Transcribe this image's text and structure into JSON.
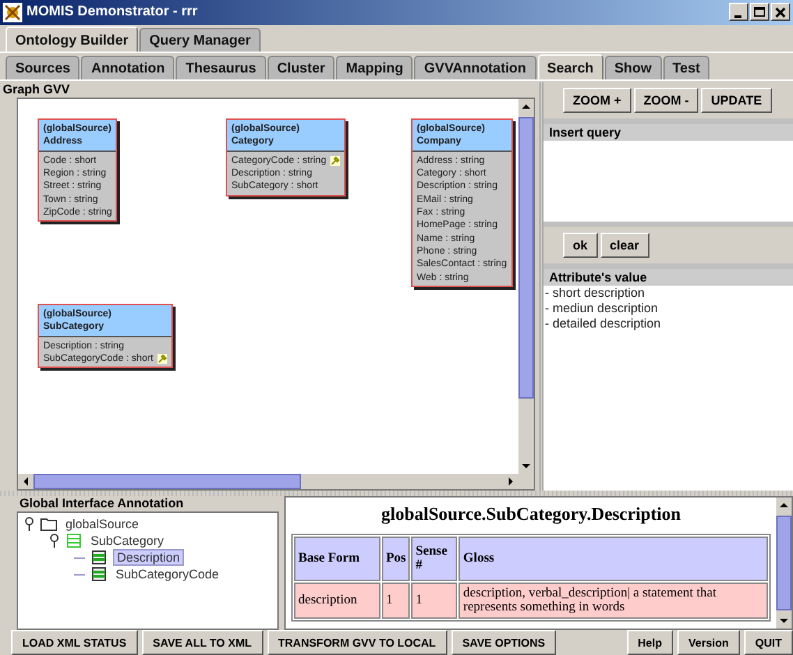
{
  "window": {
    "title": "MOMIS Demonstrator - rrr"
  },
  "top_tabs": [
    {
      "label": "Ontology Builder",
      "selected": true
    },
    {
      "label": "Query Manager",
      "selected": false
    }
  ],
  "tabs": [
    {
      "label": "Sources",
      "selected": false
    },
    {
      "label": "Annotation",
      "selected": false
    },
    {
      "label": "Thesaurus",
      "selected": false
    },
    {
      "label": "Cluster",
      "selected": false
    },
    {
      "label": "Mapping",
      "selected": false
    },
    {
      "label": "GVVAnnotation",
      "selected": false
    },
    {
      "label": "Search",
      "selected": true
    },
    {
      "label": "Show",
      "selected": false
    },
    {
      "label": "Test",
      "selected": false
    }
  ],
  "graph": {
    "title": "Graph GVV",
    "nodes": [
      {
        "source": "(globalSource)",
        "name": "Address",
        "attributes": [
          {
            "text": "Code : short",
            "key": false
          },
          {
            "text": "Region : string",
            "key": false
          },
          {
            "text": "Street : string",
            "key": false
          },
          {
            "text": "Town : string",
            "key": false
          },
          {
            "text": "ZipCode : string",
            "key": false
          }
        ]
      },
      {
        "source": "(globalSource)",
        "name": "Category",
        "attributes": [
          {
            "text": "CategoryCode : string",
            "key": true
          },
          {
            "text": "Description : string",
            "key": false
          },
          {
            "text": "SubCategory : short",
            "key": false
          }
        ]
      },
      {
        "source": "(globalSource)",
        "name": "Company",
        "attributes": [
          {
            "text": "Address : string",
            "key": false
          },
          {
            "text": "Category : short",
            "key": false
          },
          {
            "text": "Description : string",
            "key": false
          },
          {
            "text": "EMail : string",
            "key": false
          },
          {
            "text": "Fax : string",
            "key": false
          },
          {
            "text": "HomePage : string",
            "key": false
          },
          {
            "text": "Name : string",
            "key": false
          },
          {
            "text": "Phone : string",
            "key": false
          },
          {
            "text": "SalesContact : string",
            "key": false
          },
          {
            "text": "Web : string",
            "key": false
          }
        ]
      },
      {
        "source": "(globalSource)",
        "name": "SubCategory",
        "attributes": [
          {
            "text": "Description : string",
            "key": false
          },
          {
            "text": "SubCategoryCode : short",
            "key": true
          }
        ]
      }
    ]
  },
  "graph_buttons": [
    "ZOOM +",
    "ZOOM -",
    "UPDATE"
  ],
  "query": {
    "title": "Insert query",
    "buttons": [
      "ok",
      "clear"
    ]
  },
  "attribute_values": {
    "title": "Attribute's value",
    "items": [
      "- short description",
      "- mediun description",
      "- detailed description"
    ]
  },
  "annotation_tree": {
    "title": "Global Interface Annotation",
    "items": [
      {
        "label": "globalSource",
        "kind": "folder",
        "expanded": true,
        "selected": false,
        "children": [
          {
            "label": "SubCategory",
            "kind": "table",
            "expanded": true,
            "selected": false,
            "children": [
              {
                "label": "Description",
                "kind": "field",
                "selected": true
              },
              {
                "label": "SubCategoryCode",
                "kind": "field",
                "selected": false
              }
            ]
          }
        ]
      }
    ]
  },
  "gloss": {
    "heading": "globalSource.SubCategory.Description",
    "columns": [
      "Base Form",
      "Pos",
      "Sense #",
      "Gloss"
    ],
    "rows": [
      [
        "description",
        "1",
        "1",
        "description, verbal_description| a statement that represents something in words"
      ]
    ]
  },
  "footer_buttons_left": [
    "LOAD XML STATUS",
    "SAVE ALL TO XML",
    "TRANSFORM GVV TO LOCAL",
    "SAVE OPTIONS"
  ],
  "footer_buttons_right": [
    "Help",
    "Version",
    "QUIT"
  ]
}
